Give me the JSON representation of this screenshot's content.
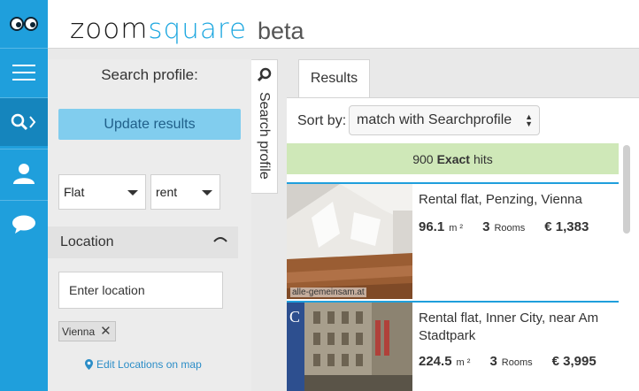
{
  "brand": {
    "zoom": "zoom",
    "square": "square",
    "beta": "beta"
  },
  "colors": {
    "brand_blue": "#1f9fdc",
    "accent_light_blue": "#81cdee",
    "hits_green": "#cfe8b8"
  },
  "rail": {
    "items": [
      {
        "icon": "eyes-logo-icon"
      },
      {
        "icon": "menu-icon"
      },
      {
        "icon": "search-icon",
        "active": true
      },
      {
        "icon": "user-icon"
      },
      {
        "icon": "chat-icon"
      }
    ]
  },
  "search_profile": {
    "title": "Search profile:",
    "update_button": "Update results",
    "property_type": "Flat",
    "transaction_type": "rent",
    "location_label": "Location",
    "location_placeholder": "Enter location",
    "location_chip": "Vienna",
    "edit_map_link": "Edit Locations on map",
    "side_tab_label": "Search profile"
  },
  "results": {
    "tab_label": "Results",
    "sort_label": "Sort by:",
    "sort_value": "match with Searchprofile",
    "hits_count": "900",
    "hits_bold": "Exact",
    "hits_suffix": "hits",
    "listings": [
      {
        "title": "Rental flat, Penzing, Vienna",
        "area": "96.1",
        "area_unit": "m ²",
        "rooms": "3",
        "rooms_unit": "Rooms",
        "price": "€ 1,383",
        "watermark": "alle-gemeinsam.at"
      },
      {
        "title": "Rental flat, Inner City, near Am Stadtpark",
        "area": "224.5",
        "area_unit": "m ²",
        "rooms": "3",
        "rooms_unit": "Rooms",
        "price": "€ 3,995"
      }
    ]
  }
}
